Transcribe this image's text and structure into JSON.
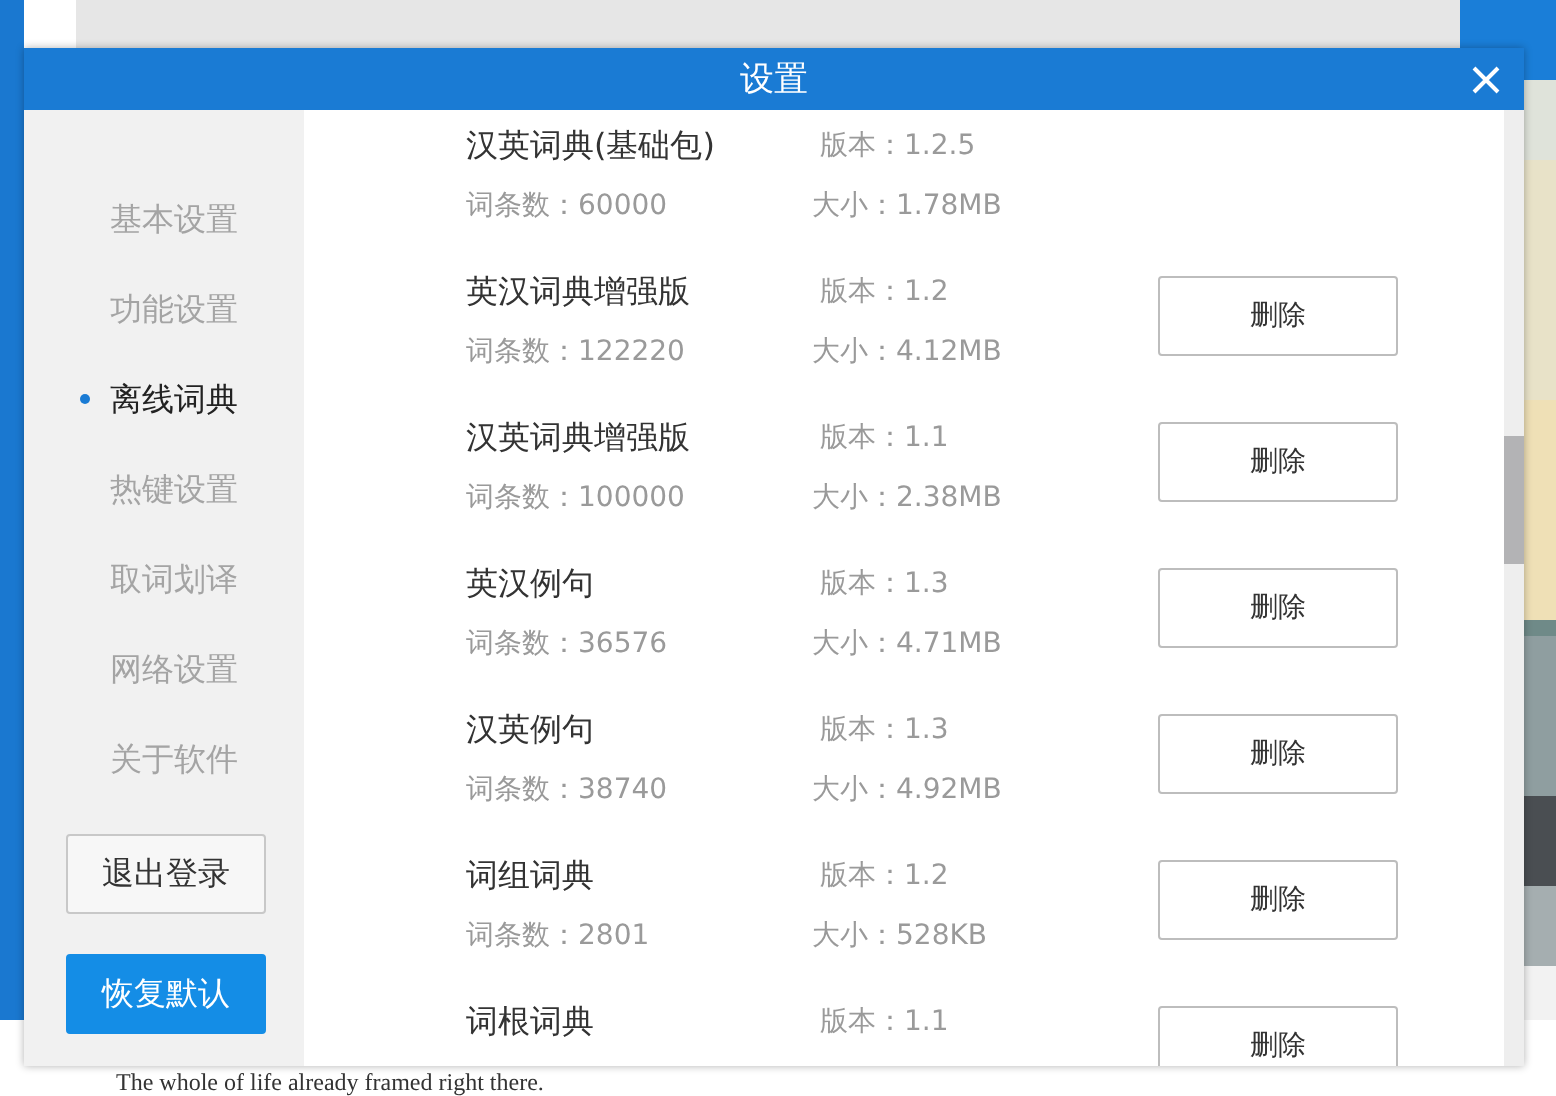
{
  "background": {
    "caption": "The whole of life already framed right there."
  },
  "dialog": {
    "title": "设置"
  },
  "sidebar": {
    "items": [
      {
        "label": "基本设置",
        "selected": false
      },
      {
        "label": "功能设置",
        "selected": false
      },
      {
        "label": "离线词典",
        "selected": true
      },
      {
        "label": "热键设置",
        "selected": false
      },
      {
        "label": "取词划译",
        "selected": false
      },
      {
        "label": "网络设置",
        "selected": false
      },
      {
        "label": "关于软件",
        "selected": false
      }
    ],
    "buttons": [
      {
        "label": "退出登录",
        "kind": "outline"
      },
      {
        "label": "恢复默认",
        "kind": "primary"
      }
    ]
  },
  "dictionaries": [
    {
      "name": "汉英词典(基础包)",
      "version": "版本：1.2.5",
      "count": "词条数：60000",
      "size": "大小：1.78MB"
    },
    {
      "name": "英汉词典增强版",
      "version": "版本：1.2",
      "count": "词条数：122220",
      "size": "大小：4.12MB",
      "action": "删除"
    },
    {
      "name": "汉英词典增强版",
      "version": "版本：1.1",
      "count": "词条数：100000",
      "size": "大小：2.38MB",
      "action": "删除"
    },
    {
      "name": "英汉例句",
      "version": "版本：1.3",
      "count": "词条数：36576",
      "size": "大小：4.71MB",
      "action": "删除"
    },
    {
      "name": "汉英例句",
      "version": "版本：1.3",
      "count": "词条数：38740",
      "size": "大小：4.92MB",
      "action": "删除"
    },
    {
      "name": "词组词典",
      "version": "版本：1.2",
      "count": "词条数：2801",
      "size": "大小：528KB",
      "action": "删除"
    },
    {
      "name": "词根词典",
      "version": "版本：1.1",
      "action": "删除"
    }
  ]
}
